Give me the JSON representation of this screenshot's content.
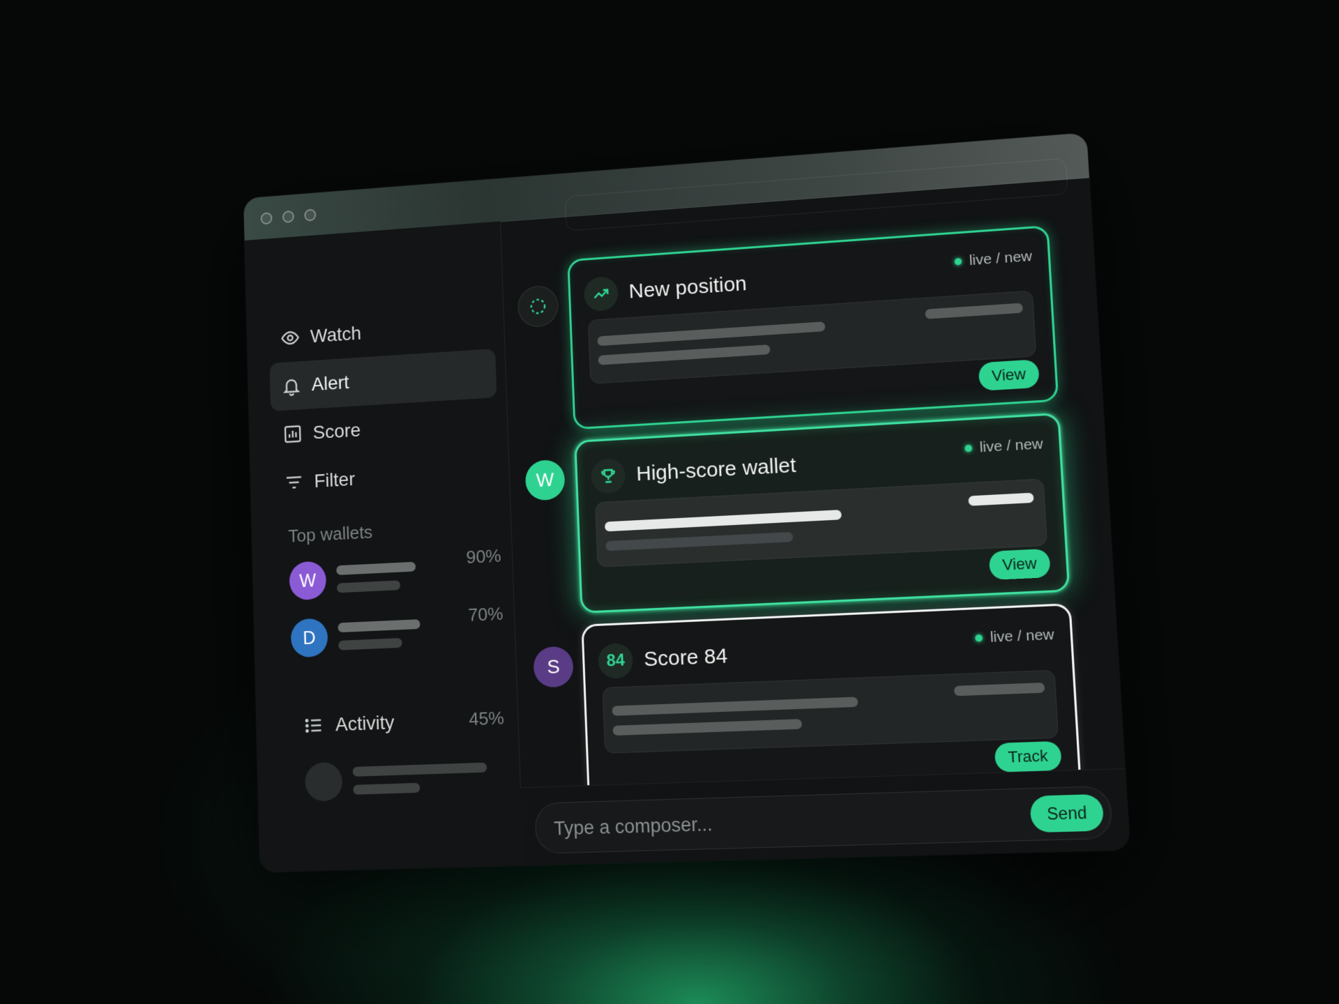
{
  "sidebar": {
    "items": [
      {
        "label": "Watch",
        "icon": "eye-icon"
      },
      {
        "label": "Alert",
        "icon": "bell-icon",
        "active": true
      },
      {
        "label": "Score",
        "icon": "chart-icon"
      },
      {
        "label": "Filter",
        "icon": "filter-icon"
      }
    ],
    "top_wallets_label": "Top wallets",
    "wallets": [
      {
        "initial": "W",
        "percent": "90%",
        "color": "#8b5bd6"
      },
      {
        "initial": "D",
        "percent": "70%",
        "color": "#2f74c0"
      }
    ],
    "activity": {
      "label": "Activity",
      "percent": "45%",
      "icon": "list-icon"
    }
  },
  "feed": {
    "cards": [
      {
        "avatar_icon": "loader-icon",
        "icon": "trend-up-icon",
        "title": "New position",
        "status": "live / new",
        "action": "View"
      },
      {
        "avatar_initial": "W",
        "avatar_color": "#2fd391",
        "icon": "trophy-icon",
        "title": "High-score wallet",
        "status": "live / new",
        "action": "View"
      },
      {
        "avatar_initial": "S",
        "avatar_color": "#5a3c86",
        "badge": "84",
        "title": "Score 84",
        "status": "live / new",
        "action": "Track"
      }
    ]
  },
  "composer": {
    "placeholder": "Type a composer...",
    "send_label": "Send"
  },
  "colors": {
    "accent": "#2fd391",
    "background": "#050807",
    "panel": "#111314"
  }
}
